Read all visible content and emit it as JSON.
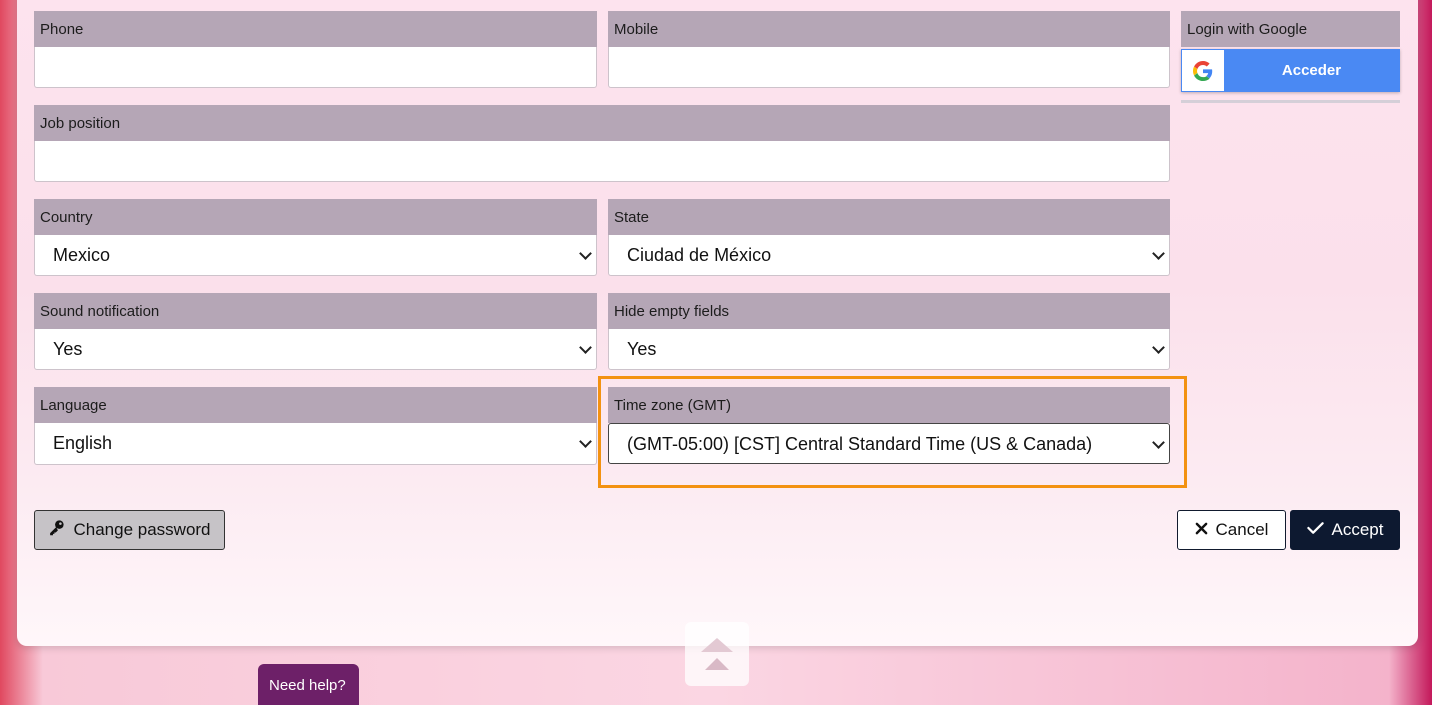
{
  "form": {
    "phone": {
      "label": "Phone",
      "value": ""
    },
    "mobile": {
      "label": "Mobile",
      "value": ""
    },
    "job_position": {
      "label": "Job position",
      "value": ""
    },
    "country": {
      "label": "Country",
      "value": "Mexico"
    },
    "state": {
      "label": "State",
      "value": "Ciudad de México"
    },
    "sound_notification": {
      "label": "Sound notification",
      "value": "Yes"
    },
    "hide_empty_fields": {
      "label": "Hide empty fields",
      "value": "Yes"
    },
    "language": {
      "label": "Language",
      "value": "English"
    },
    "time_zone": {
      "label": "Time zone (GMT)",
      "value": "(GMT-05:00) [CST] Central Standard Time (US & Canada)"
    }
  },
  "google": {
    "label": "Login with Google",
    "button": "Acceder"
  },
  "buttons": {
    "change_password": "Change password",
    "cancel": "Cancel",
    "accept": "Accept"
  },
  "help": {
    "label": "Need help?"
  },
  "colors": {
    "label_bg": "#b5a6b6",
    "highlight": "#f39211",
    "accept_bg": "#0d1930",
    "google_blue": "#4a89f3",
    "help_bg": "#6d2068"
  },
  "icons": [
    "google-icon",
    "key-icon",
    "close-icon",
    "check-icon",
    "chevron-down-icon",
    "scroll-top-icon"
  ]
}
